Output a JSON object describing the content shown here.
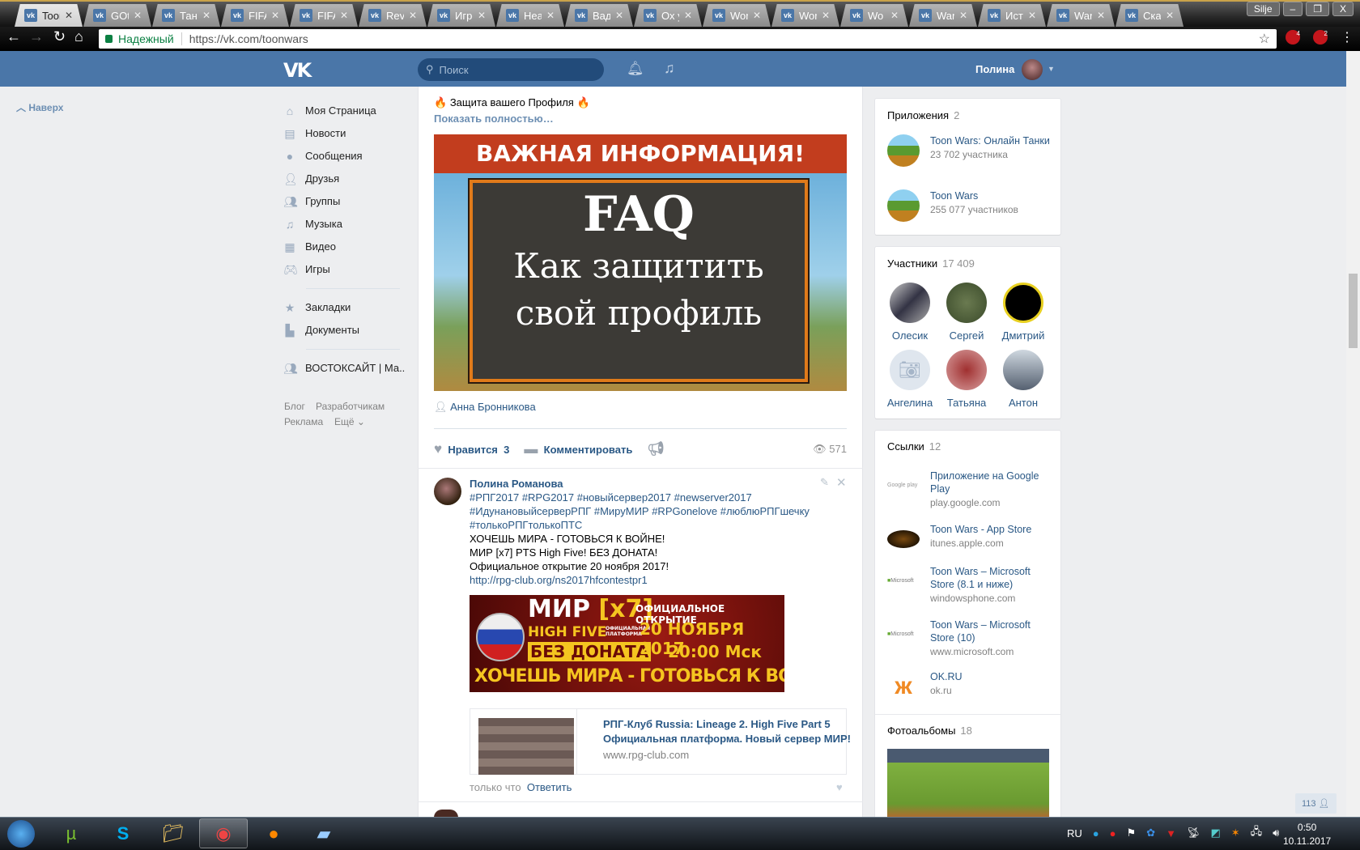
{
  "browser": {
    "tabs": [
      "Toon",
      "GOta",
      "Танк",
      "FIFA",
      "FIFA",
      "Reve",
      "Игро",
      "Hear",
      "Вади",
      "Ох у",
      "Worl",
      "Worl",
      "Wo",
      "War",
      "Исто",
      "War",
      "Скаі"
    ],
    "window_user": "Silje",
    "secure_label": "Надежный",
    "url": "https://vk.com/toonwars",
    "ext_badges": [
      "4",
      "2"
    ]
  },
  "header": {
    "logo": "VK",
    "search_placeholder": "Поиск",
    "user_name": "Полина"
  },
  "scroll_up": "Наверх",
  "sidebar": {
    "items": [
      "Моя Страница",
      "Новости",
      "Сообщения",
      "Друзья",
      "Группы",
      "Музыка",
      "Видео",
      "Игры"
    ],
    "items2": [
      "Закладки",
      "Документы"
    ],
    "group": "ВОСТОКСАЙТ | Ма..",
    "footer": [
      "Блог",
      "Разработчикам",
      "Реклама",
      "Ещё"
    ]
  },
  "post1": {
    "title": "Защита вашего Профиля",
    "more": "Показать полностью…",
    "image": {
      "band": "ВАЖНАЯ ИНФОРМАЦИЯ!",
      "big": "FAQ",
      "line1": "Как защитить",
      "line2": "свой профиль"
    },
    "author": "Анна Бронникова",
    "like_label": "Нравится",
    "likes": "3",
    "comment_label": "Комментировать",
    "views": "571"
  },
  "comment": {
    "author": "Полина Романова",
    "tags": [
      "#РПГ2017 #RPG2017 #новыйсервер2017 #newserver2017",
      "#ИдунановыйсерверРПГ #МируМИР #RPGonelove #люблюРПГшечку",
      "#толькоРПГтолькоПТС"
    ],
    "lines": [
      "ХОЧЕШЬ МИРА - ГОТОВЬСЯ К ВОЙНЕ!",
      "МИР [x7] PTS High Five! БЕЗ ДОНАТА!",
      "Официальное открытие 20 ноября 2017!"
    ],
    "link": "http://rpg-club.org/ns2017hfcontestpr1",
    "banner": {
      "mir": "МИР",
      "x7": "[x7]",
      "hf": "HIGH FIVE",
      "platform": "ОФИЦИАЛЬНАЯ ПЛАТФОРМА",
      "nodonate": "БЕЗ ДОНАТА",
      "opening": "ОФИЦИАЛЬНОЕ ОТКРЫТИЕ",
      "date": "20 НОЯБРЯ 2017",
      "time": "20:00 Мск",
      "slogan": "ХОЧЕШЬ МИРА - ГОТОВЬСЯ К ВОЙНЕ"
    },
    "card_title1": "РПГ-Клуб Russia: Lineage 2. High Five Part 5",
    "card_title2": "Официальная платформа. Новый сервер МИР!",
    "card_url": "www.rpg-club.com",
    "time": "только что",
    "reply": "Ответить"
  },
  "apps": {
    "title": "Приложения",
    "count": "2",
    "items": [
      {
        "name": "Toon Wars: Онлайн Танки",
        "sub": "23 702 участника"
      },
      {
        "name": "Toon Wars",
        "sub": "255 077 участников"
      }
    ]
  },
  "members": {
    "title": "Участники",
    "count": "17 409",
    "items": [
      "Олесик",
      "Сергей",
      "Дмитрий",
      "Ангелина",
      "Татьяна",
      "Антон"
    ]
  },
  "links": {
    "title": "Ссылки",
    "count": "12",
    "items": [
      {
        "name": "Приложение на Google Play",
        "sub": "play.google.com",
        "logo": "Google play"
      },
      {
        "name": "Toon Wars - App Store",
        "sub": "itunes.apple.com",
        "logo": ""
      },
      {
        "name": "Toon Wars – Microsoft Store (8.1 и ниже)",
        "sub": "windowsphone.com",
        "logo": "Microsoft"
      },
      {
        "name": "Toon Wars – Microsoft Store (10)",
        "sub": "www.microsoft.com",
        "logo": "Microsoft"
      },
      {
        "name": "OK.RU",
        "sub": "ok.ru",
        "logo": ""
      }
    ]
  },
  "albums": {
    "title": "Фотоальбомы",
    "count": "18"
  },
  "online_counter": "113",
  "taskbar": {
    "lang": "RU",
    "time": "0:50",
    "date": "10.11.2017"
  }
}
